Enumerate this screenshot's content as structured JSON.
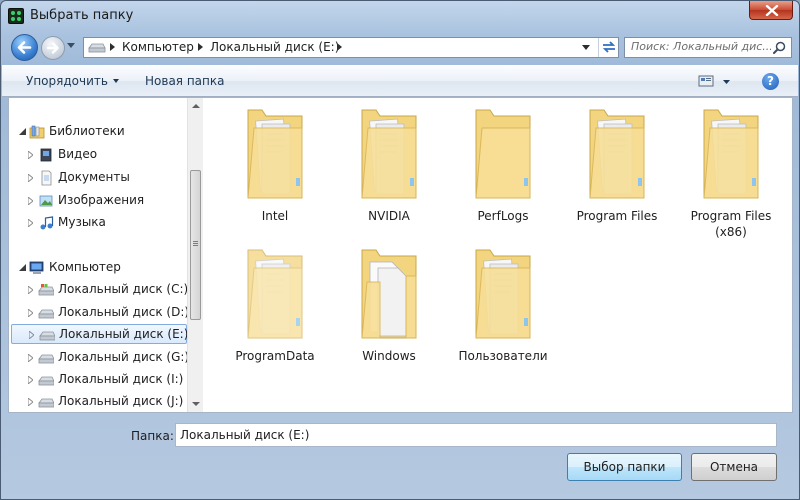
{
  "window": {
    "title": "Выбрать папку"
  },
  "address": {
    "crumbs": [
      "Компьютер",
      "Локальный диск (E:)"
    ]
  },
  "search": {
    "placeholder": "Поиск: Локальный дис..."
  },
  "toolbar": {
    "organize": "Упорядочить",
    "new_folder": "Новая папка"
  },
  "tree": {
    "libraries": {
      "label": "Библиотеки",
      "items": [
        "Видео",
        "Документы",
        "Изображения",
        "Музыка"
      ]
    },
    "computer": {
      "label": "Компьютер",
      "items": [
        "Локальный диск (C:)",
        "Локальный диск (D:)",
        "Локальный диск (E:)",
        "Локальный диск (G:)",
        "Локальный диск (I:)",
        "Локальный диск (J:)"
      ]
    },
    "selected": "Локальный диск (E:)"
  },
  "folders": [
    "Intel",
    "NVIDIA",
    "PerfLogs",
    "Program Files",
    "Program Files (x86)",
    "ProgramData",
    "Windows",
    "Пользователи"
  ],
  "bottom": {
    "folder_label": "Папка:",
    "folder_value": "Локальный диск (E:)",
    "select_button": "Выбор папки",
    "cancel_button": "Отмена"
  },
  "icons": {
    "app": "app-icon",
    "close": "close-icon",
    "back": "back-arrow-icon",
    "forward": "forward-arrow-icon",
    "drive": "drive-icon",
    "refresh": "refresh-icon",
    "search": "search-icon",
    "view": "view-icon",
    "help": "help-icon",
    "folder": "folder-icon",
    "library": "library-icon",
    "video": "video-icon",
    "documents": "documents-icon",
    "pictures": "pictures-icon",
    "music": "music-icon",
    "computer": "computer-icon"
  },
  "colors": {
    "accent": "#3a7fd1",
    "close": "#c94a32",
    "selection": "#d9e9fc",
    "folder": "#f3d47f"
  }
}
